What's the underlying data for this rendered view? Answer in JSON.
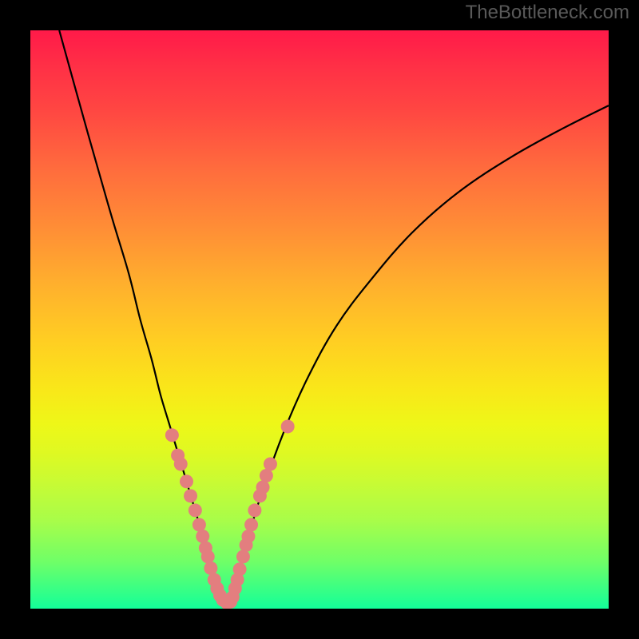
{
  "watermark": "TheBottleneck.com",
  "colors": {
    "frame": "#000000",
    "curve": "#000000",
    "dot": "#e37e7f",
    "gradient_top": "#ff1a49",
    "gradient_bottom": "#13ff99"
  },
  "chart_data": {
    "type": "line",
    "title": "",
    "xlabel": "",
    "ylabel": "",
    "xlim": [
      0,
      100
    ],
    "ylim": [
      0,
      100
    ],
    "series": [
      {
        "name": "left-curve",
        "x": [
          5,
          10,
          14,
          17,
          19,
          21,
          22.5,
          24,
          25.5,
          27,
          28.5,
          30,
          31.5,
          33,
          34
        ],
        "y": [
          100,
          82,
          68,
          58,
          50,
          43,
          37,
          32,
          27,
          22,
          17,
          12,
          7,
          3,
          0.5
        ]
      },
      {
        "name": "right-curve",
        "x": [
          34,
          35,
          37,
          40,
          44,
          48,
          53,
          59,
          66,
          74,
          83,
          92,
          100
        ],
        "y": [
          0.5,
          3,
          10,
          20,
          31,
          40,
          49,
          57,
          65,
          72,
          78,
          83,
          87
        ]
      }
    ],
    "scatter": [
      {
        "name": "dots",
        "points": [
          {
            "x": 24.5,
            "y": 30
          },
          {
            "x": 25.5,
            "y": 26.5
          },
          {
            "x": 26.0,
            "y": 25
          },
          {
            "x": 27.0,
            "y": 22
          },
          {
            "x": 27.7,
            "y": 19.5
          },
          {
            "x": 28.5,
            "y": 17
          },
          {
            "x": 29.2,
            "y": 14.5
          },
          {
            "x": 29.8,
            "y": 12.5
          },
          {
            "x": 30.3,
            "y": 10.5
          },
          {
            "x": 30.7,
            "y": 9
          },
          {
            "x": 31.2,
            "y": 7
          },
          {
            "x": 31.8,
            "y": 5
          },
          {
            "x": 32.3,
            "y": 3.5
          },
          {
            "x": 32.8,
            "y": 2.3
          },
          {
            "x": 33.3,
            "y": 1.5
          },
          {
            "x": 34.0,
            "y": 1
          },
          {
            "x": 34.6,
            "y": 1.2
          },
          {
            "x": 35.0,
            "y": 2
          },
          {
            "x": 35.4,
            "y": 3.5
          },
          {
            "x": 35.8,
            "y": 5
          },
          {
            "x": 36.2,
            "y": 6.8
          },
          {
            "x": 36.8,
            "y": 9
          },
          {
            "x": 37.3,
            "y": 11
          },
          {
            "x": 37.7,
            "y": 12.5
          },
          {
            "x": 38.2,
            "y": 14.5
          },
          {
            "x": 38.8,
            "y": 17
          },
          {
            "x": 39.7,
            "y": 19.5
          },
          {
            "x": 40.2,
            "y": 21
          },
          {
            "x": 40.8,
            "y": 23
          },
          {
            "x": 41.5,
            "y": 25
          },
          {
            "x": 44.5,
            "y": 31.5
          }
        ]
      }
    ]
  }
}
